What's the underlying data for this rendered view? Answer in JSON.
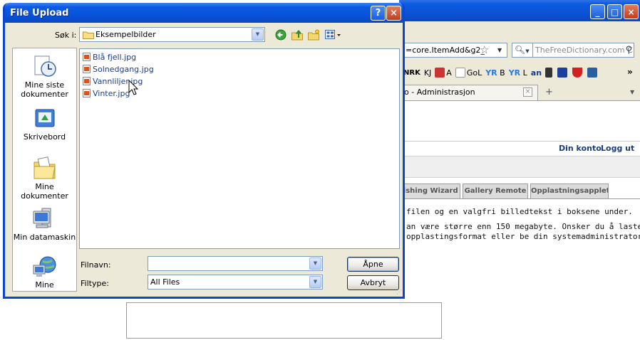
{
  "browser": {
    "url_partial": "=core.ItemAdd&g2_",
    "search_placeholder": "TheFreeDictionary.com C",
    "bookmarks": [
      "NRK",
      "KJ",
      "A",
      "GoL",
      "YR",
      "B",
      "YR",
      "L",
      "an"
    ],
    "bookmarks_more": "»",
    "tab_title": "o - Administrasjon",
    "tab_close": "×",
    "tab_new": "+",
    "tab_list": "▼",
    "minimize": "_",
    "maximize": "□",
    "close": "×"
  },
  "page": {
    "account_links": [
      "Din konto",
      "Logg ut"
    ],
    "tabs": [
      "lishing Wizard",
      "Gallery Remote",
      "Opplastningsapplet"
    ],
    "text_lines": [
      "filen og en valgfri billedtekst i boksene under.",
      "an være større enn 150 megabyte. Onsker du å laste",
      "opplastingsformat eller be din systemadministrator"
    ]
  },
  "dialog": {
    "title": "File Upload",
    "help": "?",
    "close": "×",
    "look_in_label": "Søk i:",
    "look_in_value": "Eksempelbilder",
    "places": [
      {
        "label": "Mine siste dokumenter",
        "icon": "recent-documents-icon"
      },
      {
        "label": "Skrivebord",
        "icon": "desktop-icon"
      },
      {
        "label": "Mine dokumenter",
        "icon": "my-documents-icon"
      },
      {
        "label": "Min datamaskin",
        "icon": "my-computer-icon"
      },
      {
        "label": "Mine",
        "icon": "network-places-icon"
      }
    ],
    "files": [
      "Blå fjell.jpg",
      "Solnedgang.jpg",
      "Vannliljer.jpg",
      "Vinter.jpg"
    ],
    "filename_label": "Filnavn:",
    "filename_value": "",
    "filetype_label": "Filtype:",
    "filetype_value": "All Files",
    "open_button": "Åpne",
    "cancel_button": "Avbryt"
  },
  "colors": {
    "xp_title_blue": "#0a5ae0",
    "dialog_face": "#ece9d8",
    "link_blue": "#1b3d7d"
  }
}
